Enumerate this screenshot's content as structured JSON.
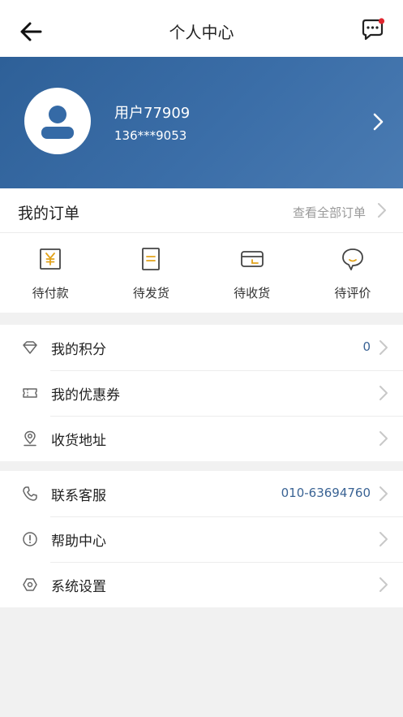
{
  "header": {
    "title": "个人中心"
  },
  "profile": {
    "username": "用户77909",
    "phone": "136***9053"
  },
  "orders": {
    "title": "我的订单",
    "view_all": "查看全部订单",
    "tabs": [
      {
        "label": "待付款",
        "icon": "yen-icon"
      },
      {
        "label": "待发货",
        "icon": "document-icon"
      },
      {
        "label": "待收货",
        "icon": "package-icon"
      },
      {
        "label": "待评价",
        "icon": "comment-icon"
      }
    ]
  },
  "menu1": [
    {
      "label": "我的积分",
      "value": "0",
      "icon": "diamond-icon"
    },
    {
      "label": "我的优惠券",
      "value": "",
      "icon": "coupon-icon"
    },
    {
      "label": "收货地址",
      "value": "",
      "icon": "location-icon"
    }
  ],
  "menu2": [
    {
      "label": "联系客服",
      "value": "010-63694760",
      "icon": "phone-icon"
    },
    {
      "label": "帮助中心",
      "value": "",
      "icon": "help-icon"
    },
    {
      "label": "系统设置",
      "value": "",
      "icon": "settings-icon"
    }
  ],
  "colors": {
    "profile_bg": "#3a6aa3",
    "accent_text": "#3a6394",
    "badge": "#e0262f"
  }
}
